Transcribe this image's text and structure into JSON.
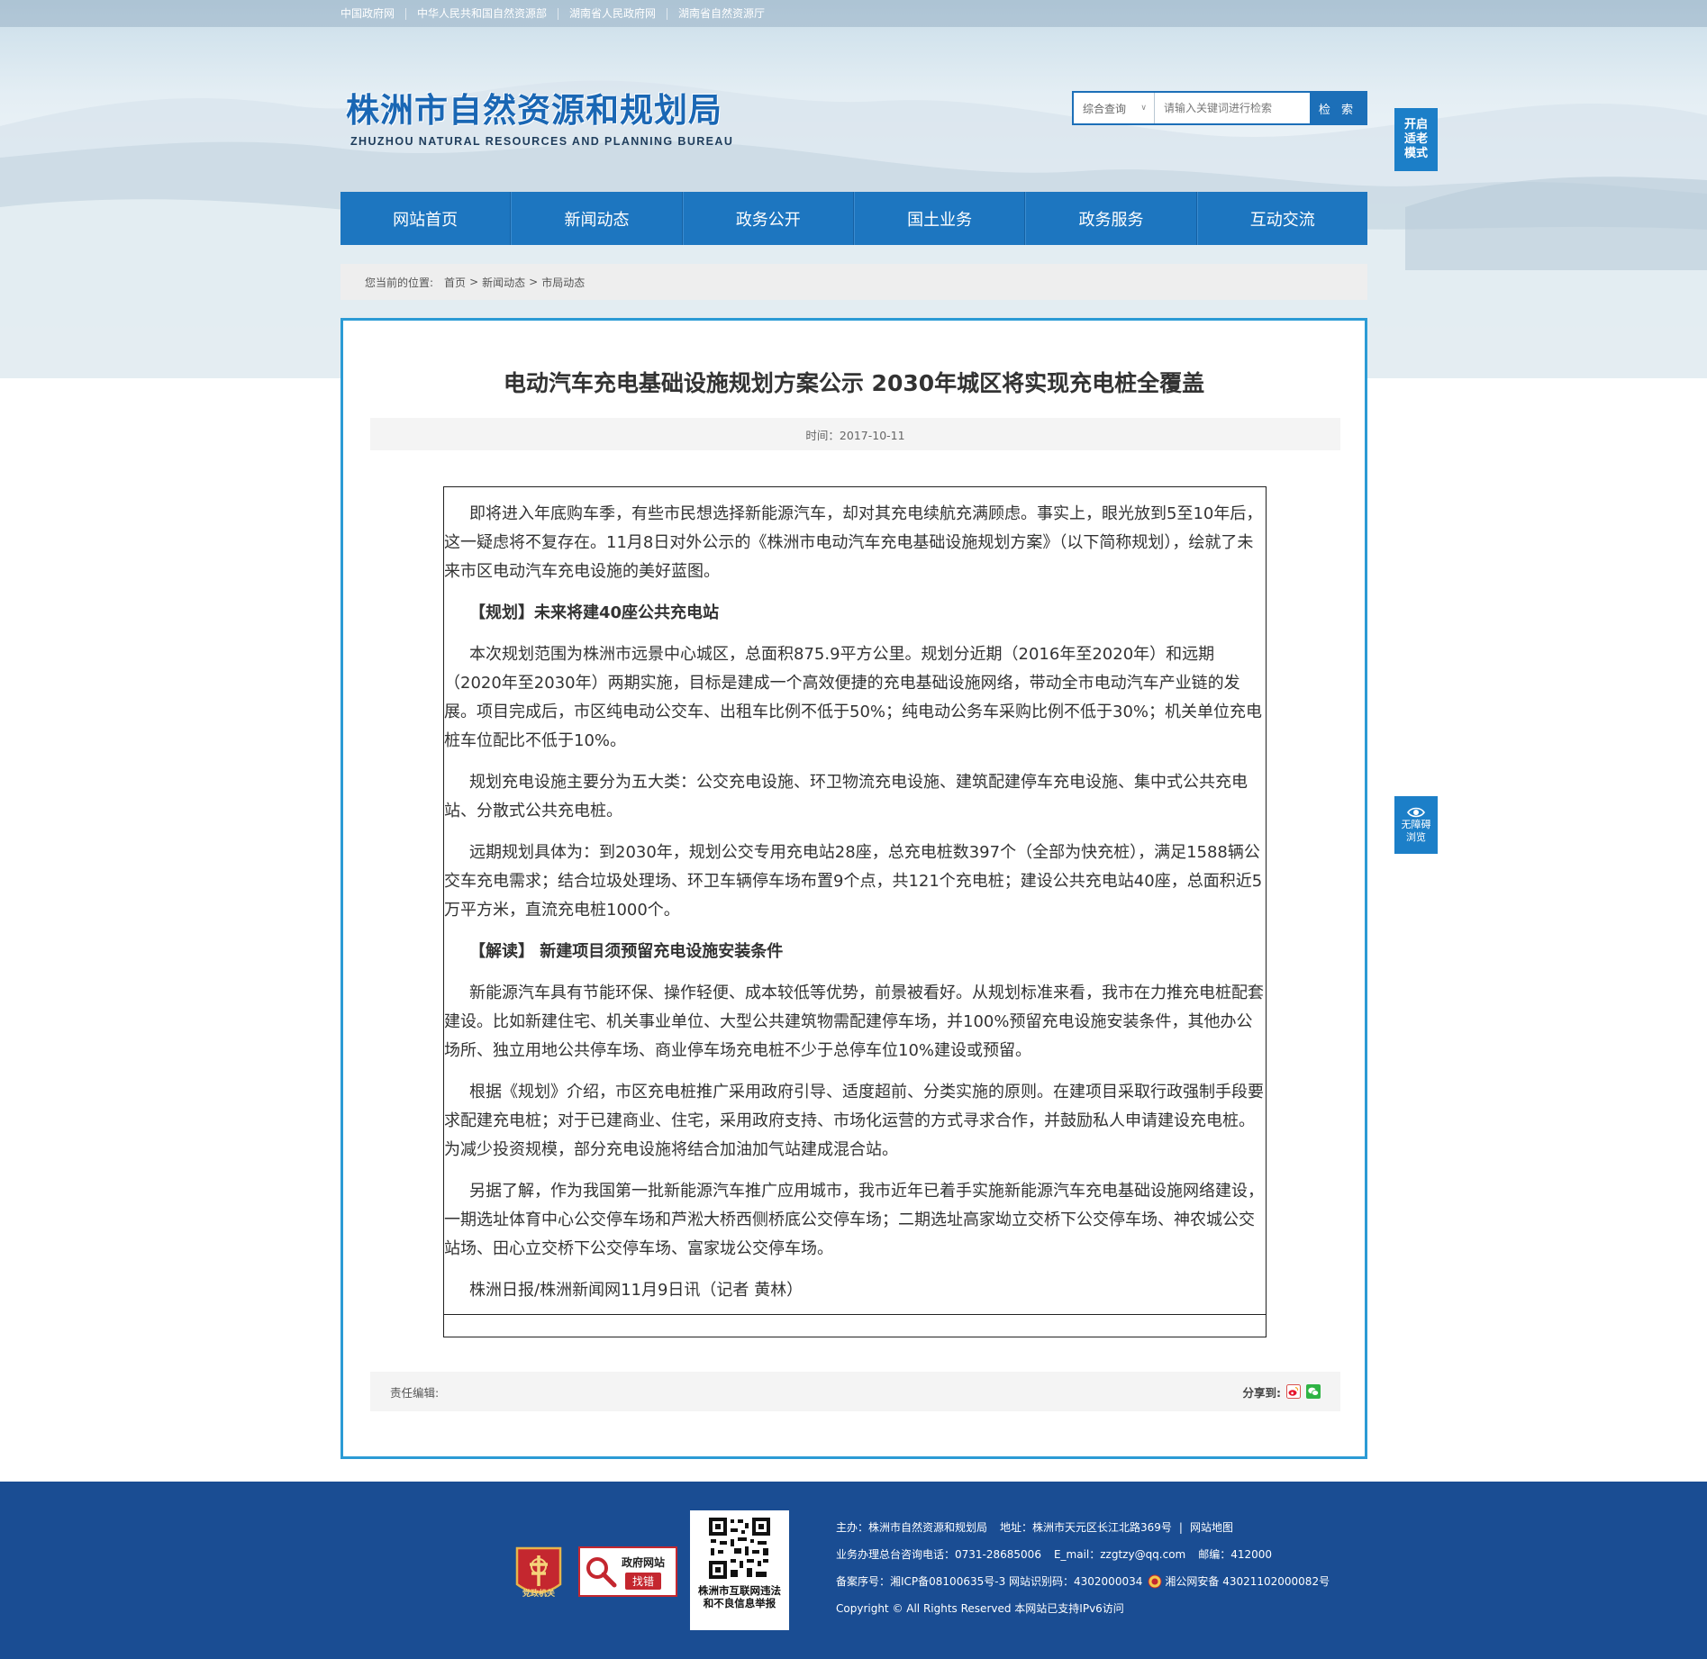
{
  "top_links": [
    "中国政府网",
    "中华人民共和国自然资源部",
    "湖南省人民政府网",
    "湖南省自然资源厅"
  ],
  "logo": {
    "cn": "株洲市自然资源和规划局",
    "en": "ZHUZHOU NATURAL RESOURCES AND PLANNING BUREAU"
  },
  "search": {
    "category": "综合查询",
    "placeholder": "请输入关键词进行检索",
    "button": "检 索"
  },
  "elder_mode": [
    "开启",
    "适老",
    "模式"
  ],
  "accessibility": [
    "无障碍",
    "浏览"
  ],
  "nav": [
    "网站首页",
    "新闻动态",
    "政务公开",
    "国土业务",
    "政务服务",
    "互动交流"
  ],
  "breadcrumb": {
    "prefix": "您当前的位置:",
    "items": [
      "首页",
      "新闻动态",
      "市局动态"
    ]
  },
  "article": {
    "title": "电动汽车充电基础设施规划方案公示 2030年城区将实现充电桩全覆盖",
    "time": "时间：2017-10-11",
    "paragraphs": [
      {
        "text": "即将进入年底购车季，有些市民想选择新能源汽车，却对其充电续航充满顾虑。事实上，眼光放到5至10年后，这一疑虑将不复存在。11月8日对外公示的《株洲市电动汽车充电基础设施规划方案》（以下简称规划），绘就了未来市区电动汽车充电设施的美好蓝图。",
        "head": false
      },
      {
        "text": "【规划】未来将建40座公共充电站",
        "head": true
      },
      {
        "text": "本次规划范围为株洲市远景中心城区，总面积875.9平方公里。规划分近期（2016年至2020年）和远期（2020年至2030年）两期实施，目标是建成一个高效便捷的充电基础设施网络，带动全市电动汽车产业链的发展。项目完成后，市区纯电动公交车、出租车比例不低于50%；纯电动公务车采购比例不低于30%；机关单位充电桩车位配比不低于10%。",
        "head": false
      },
      {
        "text": "规划充电设施主要分为五大类：公交充电设施、环卫物流充电设施、建筑配建停车充电设施、集中式公共充电站、分散式公共充电桩。",
        "head": false
      },
      {
        "text": "远期规划具体为：到2030年，规划公交专用充电站28座，总充电桩数397个（全部为快充桩），满足1588辆公交车充电需求；结合垃圾处理场、环卫车辆停车场布置9个点，共121个充电桩；建设公共充电站40座，总面积近5万平方米，直流充电桩1000个。",
        "head": false
      },
      {
        "text": "【解读】 新建项目须预留充电设施安装条件",
        "head": true
      },
      {
        "text": "新能源汽车具有节能环保、操作轻便、成本较低等优势，前景被看好。从规划标准来看，我市在力推充电桩配套建设。比如新建住宅、机关事业单位、大型公共建筑物需配建停车场，并100%预留充电设施安装条件，其他办公场所、独立用地公共停车场、商业停车场充电桩不少于总停车位10%建设或预留。",
        "head": false
      },
      {
        "text": "根据《规划》介绍，市区充电桩推广采用政府引导、适度超前、分类实施的原则。在建项目采取行政强制手段要求配建充电桩；对于已建商业、住宅，采用政府支持、市场化运营的方式寻求合作，并鼓励私人申请建设充电桩。为减少投资规模，部分充电设施将结合加油加气站建成混合站。",
        "head": false
      },
      {
        "text": "另据了解，作为我国第一批新能源汽车推广应用城市，我市近年已着手实施新能源汽车充电基础设施网络建设，一期选址体育中心公交停车场和芦淞大桥西侧桥底公交停车场；二期选址高家坳立交桥下公交停车场、神农城公交站场、田心立交桥下公交停车场、富家垅公交停车场。",
        "head": false
      },
      {
        "text": "株洲日报/株洲新闻网11月9日讯（记者 黄林）",
        "head": false
      }
    ],
    "editor": "责任编辑:",
    "share_label": "分享到:"
  },
  "footer": {
    "badge_party": "党政机关",
    "badge_gov": {
      "t1": "政府网站",
      "t2": "找错"
    },
    "qr_caption": [
      "株洲市互联网违法",
      "和不良信息举报"
    ],
    "line1": {
      "host": "主办：株洲市自然资源和规划局",
      "address": "地址：株洲市天元区长江北路369号",
      "sitemap": "网站地图"
    },
    "line2": {
      "phone": "业务办理总台咨询电话：0731-28685006",
      "email": "E_mail：zzgtzy@qq.com",
      "zip": "邮编：412000"
    },
    "line3": {
      "icp": "备案序号：湘ICP备08100635号-3 网站识别码：4302000034",
      "police": "湘公网安备 43021102000082号"
    },
    "line4": "Copyright © All Rights Reserved 本网站已支持IPv6访问"
  },
  "colors": {
    "nav": "#1d76c0",
    "frame": "#2b9bd5",
    "footer": "#1a4d93",
    "elder_tab": "#1c7fc8"
  }
}
